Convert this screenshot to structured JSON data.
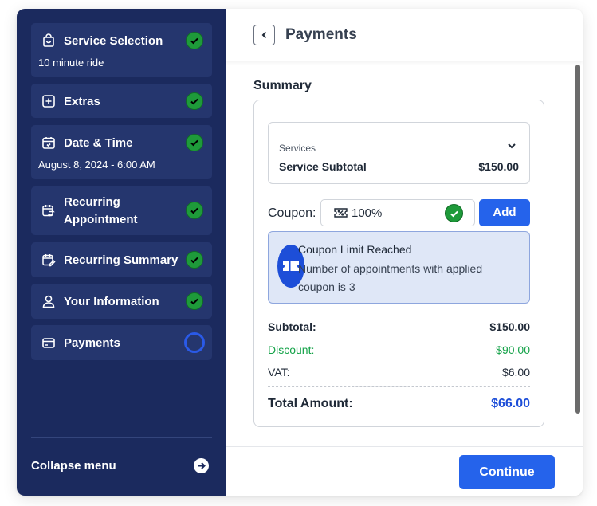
{
  "sidebar": {
    "steps": [
      {
        "label": "Service Selection",
        "sub": "10 minute ride",
        "icon": "shopping-bag-icon",
        "status": "done"
      },
      {
        "label": "Extras",
        "icon": "plus-square-icon",
        "status": "done"
      },
      {
        "label": "Date & Time",
        "sub": "August 8, 2024 - 6:00 AM",
        "icon": "calendar-icon",
        "status": "done"
      },
      {
        "label": "Recurring Appointment",
        "icon": "calendar-repeat-icon",
        "status": "done"
      },
      {
        "label": "Recurring Summary",
        "icon": "calendar-edit-icon",
        "status": "done"
      },
      {
        "label": "Your Information",
        "icon": "user-icon",
        "status": "done"
      },
      {
        "label": "Payments",
        "icon": "credit-card-icon",
        "status": "active"
      }
    ],
    "collapse_label": "Collapse menu"
  },
  "header": {
    "title": "Payments"
  },
  "summary": {
    "title": "Summary",
    "services_label": "Services",
    "service_subtotal_label": "Service Subtotal",
    "service_subtotal_value": "$150.00",
    "coupon_label": "Coupon:",
    "coupon_value": "100%",
    "add_label": "Add",
    "alert_title": "Coupon Limit Reached",
    "alert_message": "Number of appointments with applied coupon is 3",
    "subtotal_label": "Subtotal:",
    "subtotal_value": "$150.00",
    "discount_label": "Discount:",
    "discount_value": "$90.00",
    "vat_label": "VAT:",
    "vat_value": "$6.00",
    "total_label": "Total Amount:",
    "total_value": "$66.00"
  },
  "footer": {
    "continue_label": "Continue"
  },
  "colors": {
    "sidebar_bg": "#1b2a5e",
    "sidebar_item_bg": "#25366e",
    "success": "#1e9a3a",
    "primary": "#2563eb",
    "discount": "#16a34a"
  }
}
